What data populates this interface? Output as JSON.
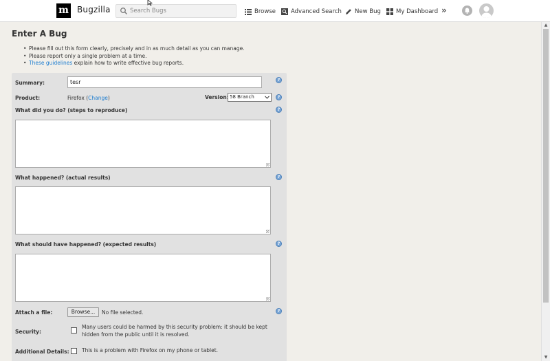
{
  "header": {
    "logo_letter": "m",
    "app_title": "Bugzilla",
    "search_placeholder": "Search Bugs",
    "nav": [
      {
        "label": "Browse",
        "icon": "list-icon"
      },
      {
        "label": "Advanced Search",
        "icon": "search-box-icon"
      },
      {
        "label": "New Bug",
        "icon": "pencil-icon"
      },
      {
        "label": "My Dashboard",
        "icon": "dashboard-icon"
      }
    ],
    "more_label": "»"
  },
  "page": {
    "title": "Enter A Bug",
    "instructions": [
      "Please fill out this form clearly, precisely and in as much detail as you can manage.",
      "Please report only a single problem at a time."
    ],
    "guidelines_link": "These guidelines",
    "guidelines_rest": " explain how to write effective bug reports."
  },
  "form": {
    "summary_label": "Summary:",
    "summary_value": "tesr",
    "product_label": "Product:",
    "product_value": "Firefox (",
    "product_change": "Change",
    "product_close": ")",
    "version_label": "Version:",
    "version_value": "58 Branch",
    "steps_label": "What did you do? (steps to reproduce)",
    "actual_label": "What happened? (actual results)",
    "expected_label": "What should have happened? (expected results)",
    "attach_label": "Attach a file:",
    "browse_label": "Browse...",
    "no_file_label": "No file selected.",
    "security_label": "Security:",
    "security_text": "Many users could be harmed by this security problem: it should be kept hidden from the public until it is resolved.",
    "details_label": "Additional Details:",
    "details_text": "This is a problem with Firefox on my phone or tablet.",
    "help_glyph": "?"
  },
  "colors": {
    "link": "#1f7ed0",
    "panel": "#e1e1e1",
    "page_bg": "#f1efea"
  }
}
